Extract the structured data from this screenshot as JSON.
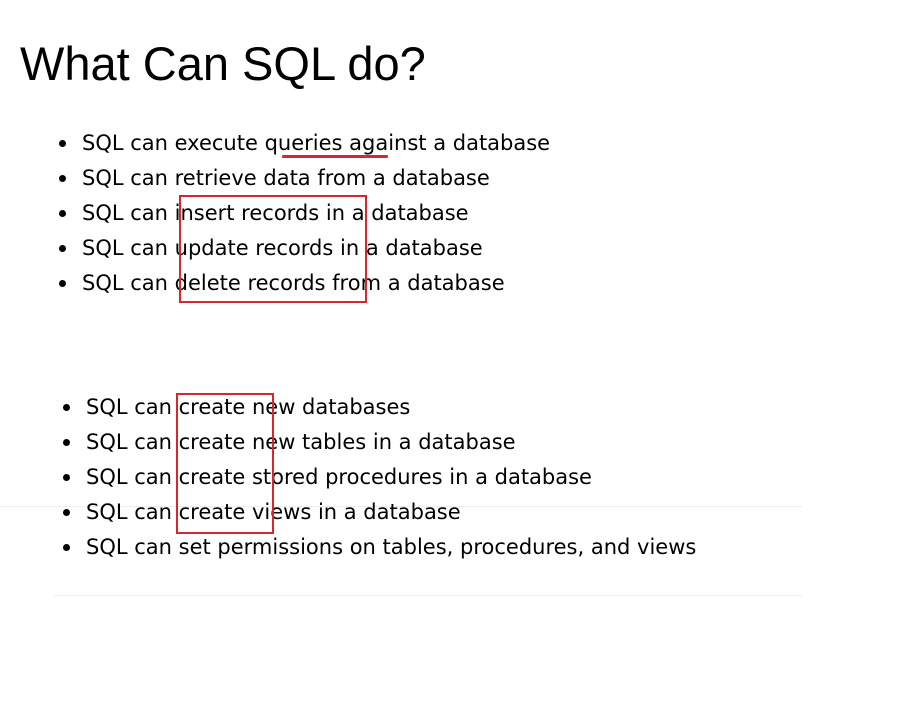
{
  "page": {
    "title": "What Can SQL do?"
  },
  "list_a": [
    "SQL can execute queries against a database",
    "SQL can retrieve data from a database",
    "SQL can insert records in a database",
    "SQL can update records in a database",
    "SQL can delete records from a database"
  ],
  "list_b": [
    "SQL can create new databases",
    "SQL can create new tables in a database",
    "SQL can create stored procedures in a database",
    "SQL can create views in a database",
    "SQL can set permissions on tables, procedures, and views"
  ],
  "colors": {
    "annotation": "#d7262e",
    "divider": "#eeeeee",
    "text": "#000000",
    "background": "#ffffff"
  }
}
